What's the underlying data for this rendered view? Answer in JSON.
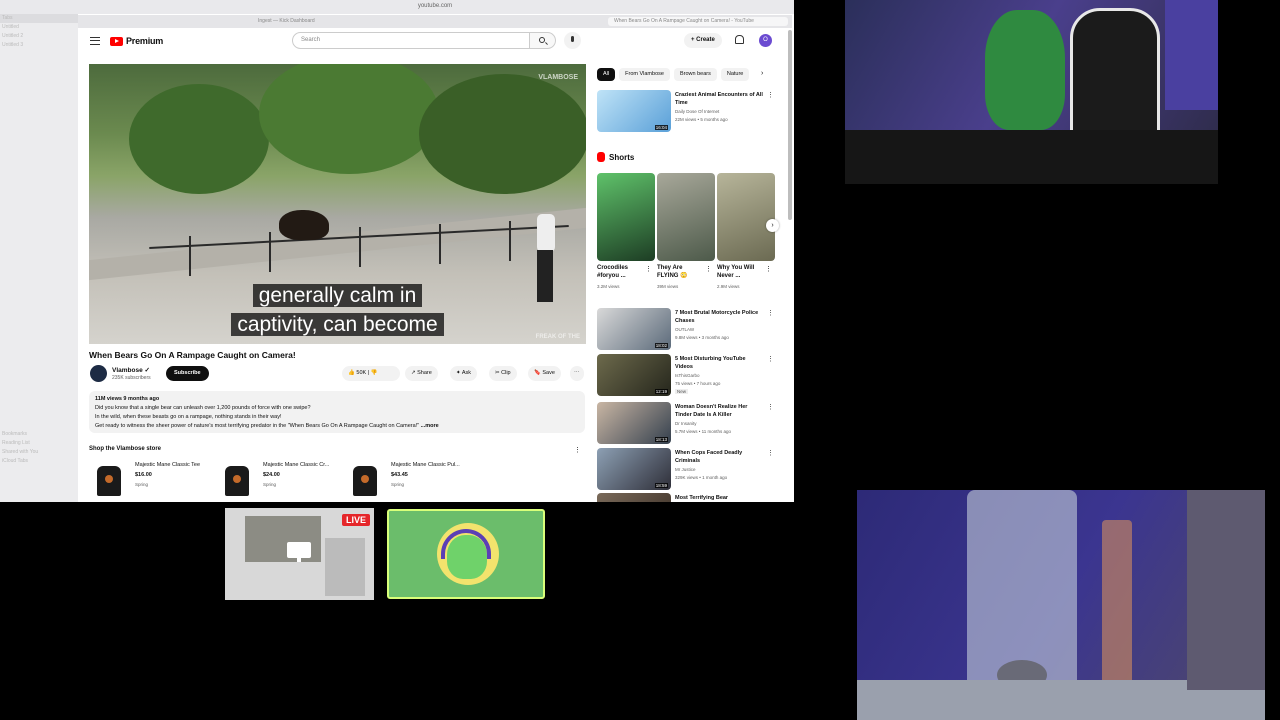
{
  "browser": {
    "address": "youtube.com",
    "tabs": [
      "Ingest — Kick Dashboard",
      "When Bears Go On A Rampage Caught on Camera! - YouTube"
    ],
    "sidebar_ghost": [
      "Tabs",
      "Untitled",
      "Untitled 2",
      "Untitled 3",
      "Bookmarks",
      "Reading List",
      "Shared with You",
      "iCloud Tabs"
    ]
  },
  "yt": {
    "logo_text": "Premium",
    "search_placeholder": "Search",
    "create_label": "Create",
    "avatar_letter": "O"
  },
  "video": {
    "watermark": "VLAMBOSE",
    "caption_line1": "generally calm in",
    "caption_line2": "captivity, can become",
    "corner_mark": "FREAK OF THE",
    "title": "When Bears Go On A Rampage Caught on Camera!",
    "channel": "Vlambose",
    "subscribers": "235K subscribers",
    "subscribe_label": "Subscribe",
    "likes": "50K",
    "share_label": "Share",
    "ask_label": "Ask",
    "clip_label": "Clip",
    "save_label": "Save"
  },
  "description": {
    "meta": "11M views  9 months ago",
    "line1": "Did you know that a single bear can unleash over 1,200 pounds of force with one swipe?",
    "line2": "In the wild, when these beasts go on a rampage, nothing stands in their way!",
    "line3": "Get ready to witness the sheer power of nature's most terrifying predator in the \"When Bears Go On A Rampage Caught on Camera!\"",
    "more": "...more"
  },
  "store": {
    "title": "Shop the Vlambose store",
    "products": [
      {
        "name": "Majestic Mane Classic Tee",
        "price": "$16.00",
        "vendor": "Spring"
      },
      {
        "name": "Majestic Mane Classic Cr...",
        "price": "$24.00",
        "vendor": "Spring"
      },
      {
        "name": "Majestic Mane Classic Pul...",
        "price": "$43.45",
        "vendor": "Spring"
      }
    ]
  },
  "chips": [
    "All",
    "From Vlambose",
    "Brown bears",
    "Nature"
  ],
  "top_reco": {
    "title": "Craziest Animal Encounters of All Time",
    "channel": "Daily Dose Of Internet",
    "views": "22M views • 5 months ago",
    "duration": "16:04"
  },
  "shorts": {
    "heading": "Shorts",
    "items": [
      {
        "title": "Crocodiles #foryou ...",
        "views": "3.2M views"
      },
      {
        "title": "They Are FLYING 😳",
        "views": "39M views"
      },
      {
        "title": "Why You Will Never ...",
        "views": "2.9M views"
      }
    ]
  },
  "recos": [
    {
      "title": "7 Most Brutal Motorcycle Police Chases",
      "channel": "OUTLAW",
      "views": "9.8M views • 3 months ago",
      "duration": "18:02"
    },
    {
      "title": "5 Most Disturbing YouTube Videos",
      "channel": "IsThisGarbo",
      "views": "75 views • 7 hours ago",
      "duration": "12:19",
      "badge": "New"
    },
    {
      "title": "Woman Doesn't Realize Her Tinder Date Is A Killer",
      "channel": "Dr Insanity",
      "views": "5.7M views • 11 months ago",
      "duration": "18:13"
    },
    {
      "title": "When Cops Faced Deadly Criminals",
      "channel": "Mr Justice",
      "views": "329K views • 1 month ago",
      "duration": "18:59"
    },
    {
      "title": "Most Terrifying Bear",
      "channel": "",
      "views": "",
      "duration": ""
    }
  ],
  "stream": {
    "live_badge": "LIVE"
  }
}
